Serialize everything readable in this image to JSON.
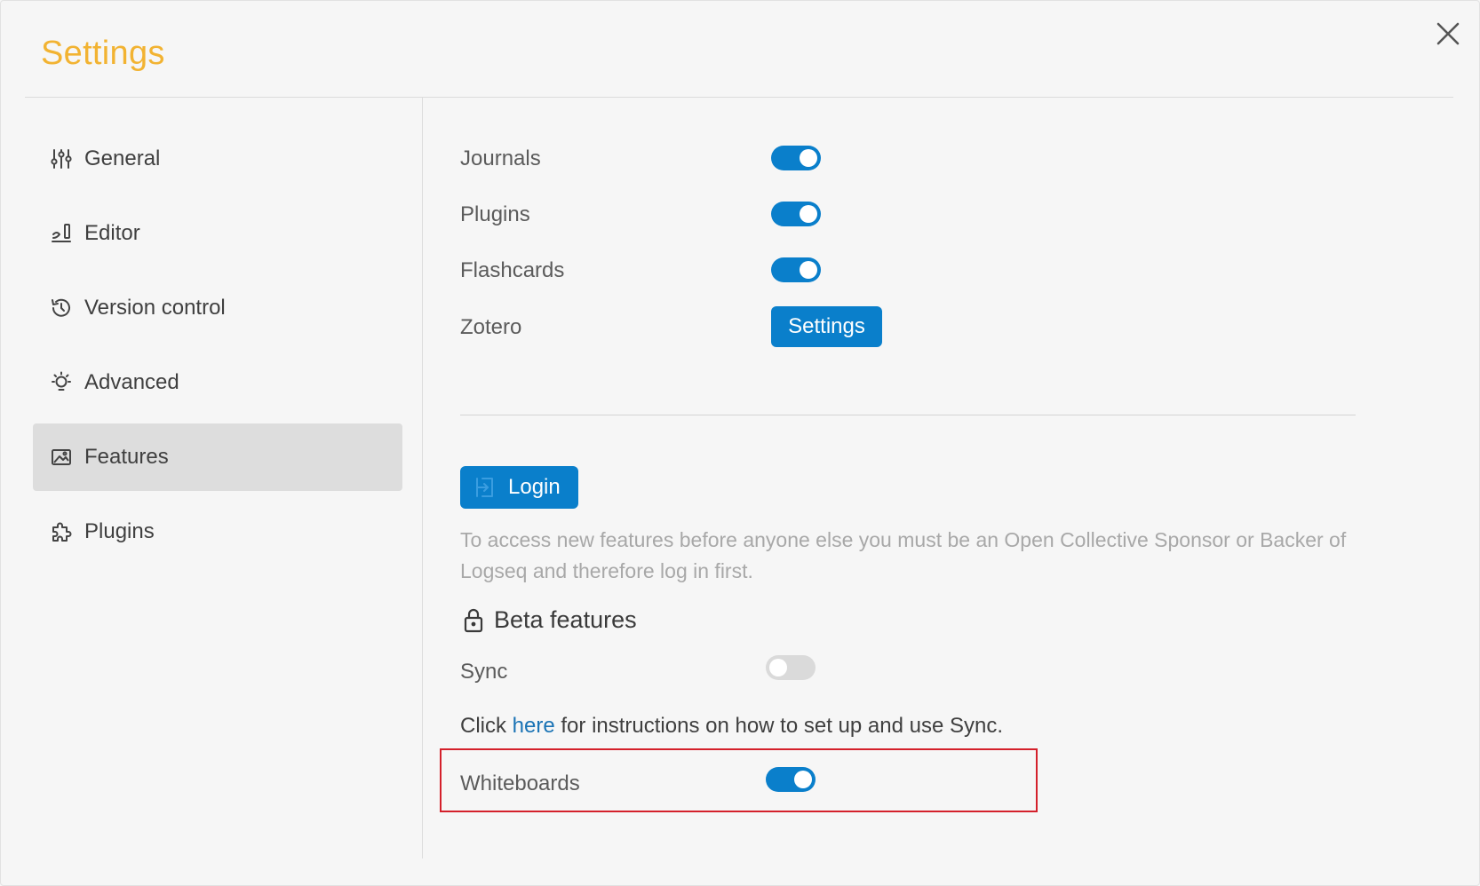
{
  "dialog": {
    "title": "Settings"
  },
  "sidebar": {
    "items": [
      {
        "label": "General",
        "icon": "sliders-icon",
        "active": false
      },
      {
        "label": "Editor",
        "icon": "editor-icon",
        "active": false
      },
      {
        "label": "Version control",
        "icon": "history-icon",
        "active": false
      },
      {
        "label": "Advanced",
        "icon": "bulb-icon",
        "active": false
      },
      {
        "label": "Features",
        "icon": "image-icon",
        "active": true
      },
      {
        "label": "Plugins",
        "icon": "puzzle-icon",
        "active": false
      }
    ]
  },
  "features": {
    "journals": {
      "label": "Journals",
      "enabled": true
    },
    "plugins": {
      "label": "Plugins",
      "enabled": true
    },
    "flashcards": {
      "label": "Flashcards",
      "enabled": true
    },
    "zotero": {
      "label": "Zotero",
      "button_label": "Settings"
    }
  },
  "account": {
    "login_label": "Login",
    "description": "To access new features before anyone else you must be an Open Collective Sponsor or Backer of Logseq and therefore log in first."
  },
  "beta": {
    "title": "Beta features",
    "sync": {
      "label": "Sync",
      "enabled": false
    },
    "sync_hint": {
      "prefix": "Click ",
      "link": "here",
      "suffix": " for instructions on how to set up and use Sync."
    },
    "whiteboards": {
      "label": "Whiteboards",
      "enabled": true
    }
  },
  "colors": {
    "title": "#f2b332",
    "accent": "#0a7fcb",
    "highlight": "#d4202b"
  }
}
